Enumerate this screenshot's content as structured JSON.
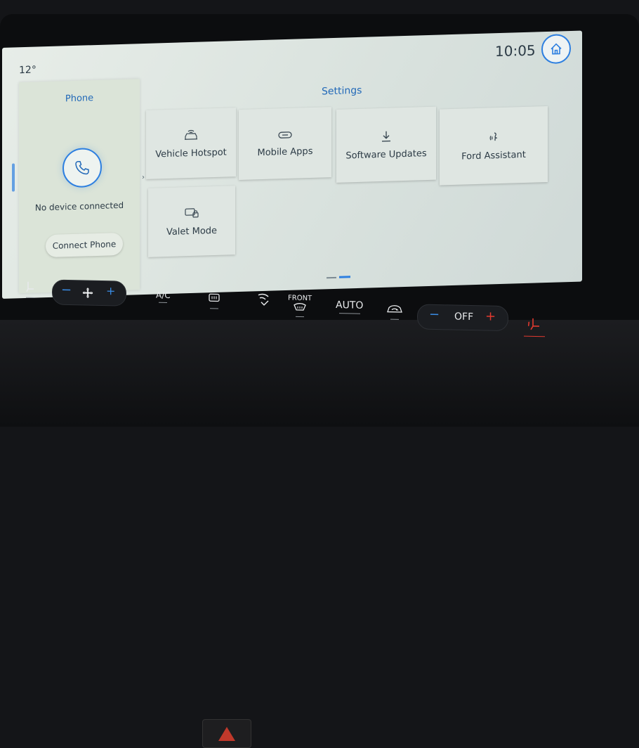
{
  "status_bar": {
    "temperature": "12°",
    "time": "10:05",
    "home_icon": "home-icon"
  },
  "phone": {
    "title": "Phone",
    "status": "No device connected",
    "connect_label": "Connect Phone",
    "icon": "phone-icon"
  },
  "settings": {
    "title": "Settings",
    "tiles": [
      {
        "label": "Vehicle Hotspot",
        "icon": "wifi-car-icon"
      },
      {
        "label": "Mobile Apps",
        "icon": "link-icon"
      },
      {
        "label": "Software Updates",
        "icon": "download-icon"
      },
      {
        "label": "Ford Assistant",
        "icon": "voice-icon"
      },
      {
        "label": "Valet Mode",
        "icon": "valet-lock-icon"
      }
    ]
  },
  "climate": {
    "ac_label": "A/C",
    "front_label": "FRONT",
    "auto_label": "AUTO",
    "fan_label": "OFF"
  },
  "colors": {
    "accent": "#2d7fe0",
    "screen_bg": "#e3eae6",
    "heat_red": "#e03a2f"
  }
}
